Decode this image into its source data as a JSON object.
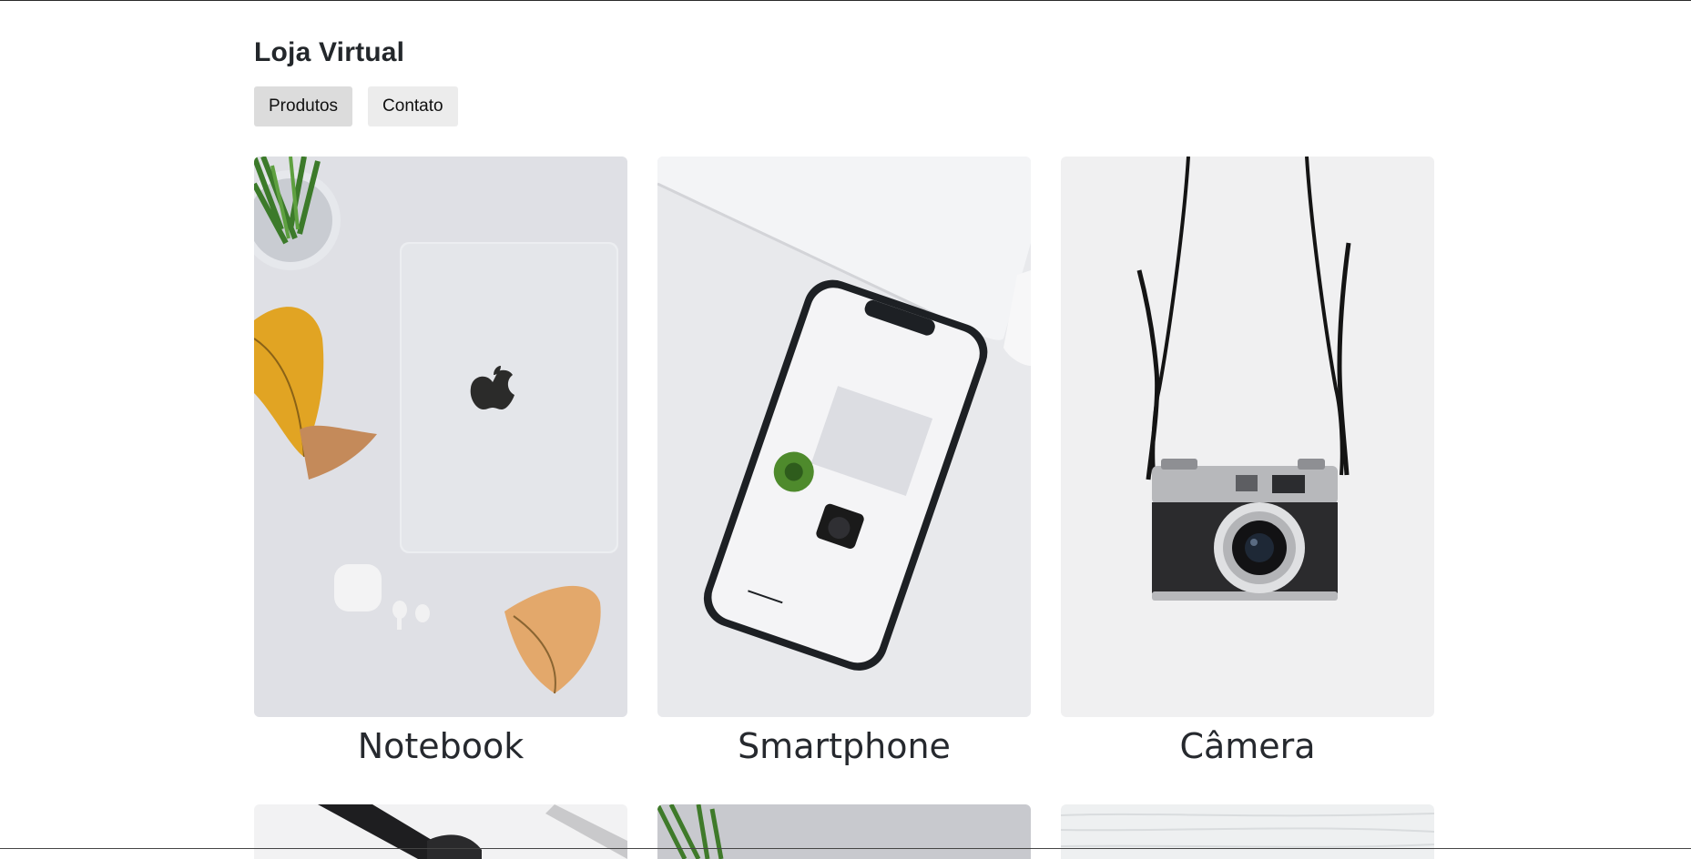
{
  "header": {
    "title": "Loja Virtual"
  },
  "nav": {
    "items": [
      {
        "label": "Produtos"
      },
      {
        "label": "Contato"
      }
    ]
  },
  "products": [
    {
      "title": "Notebook",
      "image_icon": "notebook-photo"
    },
    {
      "title": "Smartphone",
      "image_icon": "smartphone-photo"
    },
    {
      "title": "Câmera",
      "image_icon": "camera-photo"
    }
  ],
  "colors": {
    "nav_bg": "#ececec",
    "nav_active_bg": "#dcdcdc",
    "text": "#23272b"
  }
}
